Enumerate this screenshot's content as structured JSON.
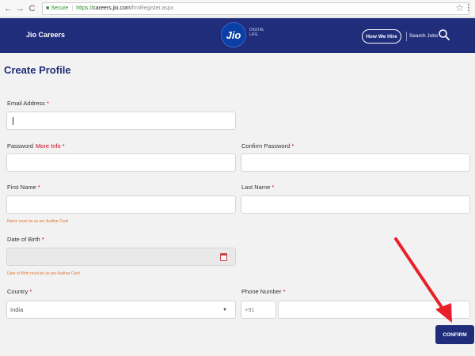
{
  "browser": {
    "back_icon": "←",
    "forward_icon": "→",
    "reload_icon": "C",
    "secure_label": "Secure",
    "url_protocol": "https://",
    "url_host": "careers.jio.com",
    "url_path": "/frmRegister.aspx"
  },
  "header": {
    "brand": "Jio Careers",
    "logo_text": "Jio",
    "logo_tagline": "DIGITAL LIFE",
    "hire_button": "How We Hire",
    "search_label": "Search Jobs"
  },
  "page": {
    "title": "Create Profile"
  },
  "form": {
    "email_label": "Email Address",
    "password_label": "Password",
    "more_info": "More Info",
    "confirm_password_label": "Confirm Password",
    "first_name_label": "First Name",
    "last_name_label": "Last Name",
    "name_hint": "Name must be as per Aadhar Card",
    "dob_label": "Date of Birth",
    "dob_hint": "Date of Birth must be as per Aadhar Card",
    "country_label": "Country",
    "country_value": "India",
    "phone_label": "Phone Number",
    "phone_code": "+91",
    "required_mark": "*",
    "confirm_button": "CONFIRM"
  },
  "colors": {
    "header_bg": "#1f2d7a",
    "required": "#d0021b",
    "hint": "#e07a3a",
    "annotation_arrow": "#e8202a"
  }
}
